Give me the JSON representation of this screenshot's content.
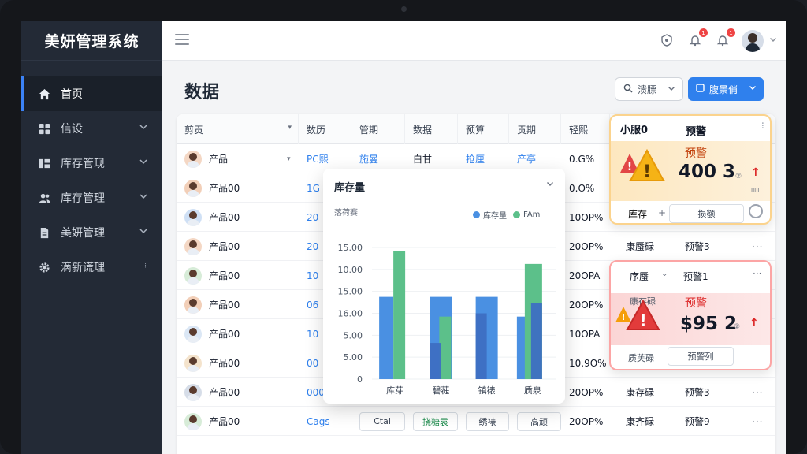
{
  "sidebar": {
    "brand": "美妍管理系统",
    "items": [
      {
        "label": "首页",
        "icon": "home-icon",
        "active": true
      },
      {
        "label": "信设",
        "icon": "grid-icon"
      },
      {
        "label": "库存管现",
        "icon": "inventory-icon"
      },
      {
        "label": "库存管理",
        "icon": "users-icon"
      },
      {
        "label": "美妍管理",
        "icon": "document-icon"
      },
      {
        "label": "滴新谎理",
        "icon": "gear-icon"
      }
    ]
  },
  "topbar": {
    "badges": [
      "1",
      "1"
    ]
  },
  "main": {
    "title": "数据",
    "filter_label": "溃膘",
    "primary_label": "腹景俏"
  },
  "table": {
    "headers": [
      "剪贡",
      "数历",
      "管期",
      "数据",
      "预算",
      "贡期",
      "轻熙"
    ],
    "rows": [
      {
        "name": "产品",
        "c1": "PC熙",
        "c2": "施曼",
        "c3": "白甘",
        "c4": "抢厘",
        "c5": "产亭",
        "c6": "0.G%",
        "c7": "",
        "c8": ""
      },
      {
        "name": "产品00",
        "c1": "1G",
        "c2": "",
        "c3": "",
        "c4": "",
        "c5": "",
        "c6": "0.O%",
        "c7": "",
        "c8": ""
      },
      {
        "name": "产品00",
        "c1": "20",
        "c2": "",
        "c3": "",
        "c4": "",
        "c5": "",
        "c6": "10OP%",
        "c7": "",
        "c8": ""
      },
      {
        "name": "产品00",
        "c1": "20",
        "c2": "",
        "c3": "",
        "c4": "",
        "c5": "",
        "c6": "20OP%",
        "c7": "康蜃碌",
        "c8": "预警3"
      },
      {
        "name": "产品00",
        "c1": "10",
        "c2": "",
        "c3": "",
        "c4": "",
        "c5": "",
        "c6": "20OPA",
        "c7": "",
        "c8": ""
      },
      {
        "name": "产品00",
        "c1": "06",
        "c2": "",
        "c3": "",
        "c4": "",
        "c5": "",
        "c6": "20OP%",
        "c7": "",
        "c8": ""
      },
      {
        "name": "产品00",
        "c1": "10",
        "c2": "",
        "c3": "",
        "c4": "",
        "c5": "",
        "c6": "10OPA",
        "c7": "",
        "c8": ""
      },
      {
        "name": "产品00",
        "c1": "00",
        "c2": "",
        "c3": "",
        "c4": "",
        "c5": "",
        "c6": "10.9O%",
        "c7": "",
        "c8": ""
      },
      {
        "name": "产品00",
        "c1": "000",
        "c2": "",
        "c3": "",
        "c4": "",
        "c5": "",
        "c6": "20OP%",
        "c7": "康存碌",
        "c8": "预警3"
      },
      {
        "name": "产品00",
        "c1": "Cags",
        "c2": "Ctai",
        "c3": "挠糖袁",
        "c4": "绣裱",
        "c5": "高顽",
        "c6": "20OP%",
        "c7": "康齐碌",
        "c8": "预警9"
      }
    ]
  },
  "chart_card": {
    "title": "库存量",
    "ylabel": "落荷赛"
  },
  "chart_data": {
    "type": "bar",
    "categories": [
      "库芽",
      "碧蓰",
      "镇裱",
      "质泉"
    ],
    "ylabels": [
      "15.00",
      "10.00",
      "15.00",
      "16.00",
      "5.00",
      "5.00",
      "0"
    ],
    "series": [
      {
        "name": "库存量",
        "color": "#4a90e2",
        "values": [
          12.5,
          12.5,
          12.5,
          9.5
        ]
      },
      {
        "name": "FAm",
        "color": "#5cc08a",
        "values": [
          19.5,
          9.5,
          0,
          17.5
        ]
      },
      {
        "name": "",
        "color": "#3d6fc2",
        "values": [
          0,
          5.5,
          10,
          11.5
        ]
      }
    ]
  },
  "alert1": {
    "title": "小服0",
    "badge": "预警",
    "label": "预警",
    "value": "400 3",
    "unit": "②",
    "small": "ⅠⅠⅠⅠⅠ",
    "foot_left": "库存",
    "foot_mid": "损额"
  },
  "alert2": {
    "hdr_left": "序蜃",
    "hdr_right": "预警1",
    "label_small": "康存碌",
    "label": "预警",
    "value": "$95 2",
    "unit": "②",
    "foot_left": "质芙碌",
    "foot_mid": "预警列"
  }
}
